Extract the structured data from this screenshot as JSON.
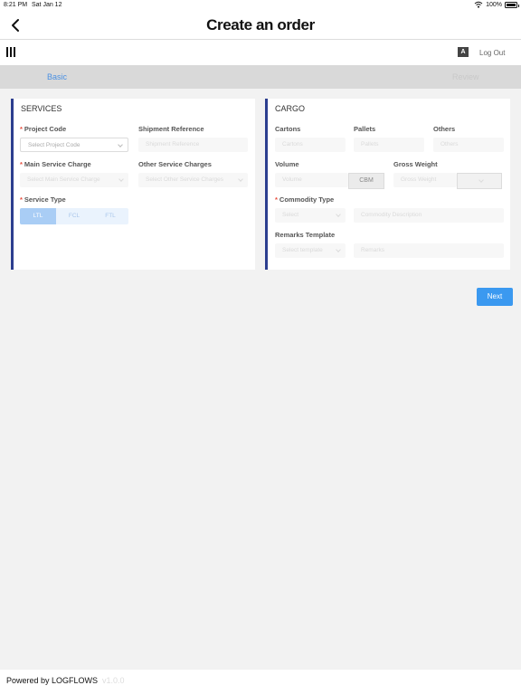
{
  "status_bar": {
    "time": "8:21 PM",
    "date": "Sat Jan 12",
    "battery": "100%",
    "battery_level": 1.0
  },
  "header": {
    "title": "Create an order"
  },
  "toolbar": {
    "logout_label": "Log Out",
    "lang_icon_glyph": "A"
  },
  "tabs": [
    {
      "label": "Basic"
    },
    {
      "label": "Review"
    }
  ],
  "services": {
    "title": "SERVICES",
    "project_code": {
      "label": "Project Code",
      "placeholder": "Select Project Code"
    },
    "shipment_reference": {
      "label": "Shipment Reference",
      "placeholder": "Shipment Reference"
    },
    "main_service_charge": {
      "label": "Main Service Charge",
      "placeholder": "Select Main Service Charge"
    },
    "other_service_charges": {
      "label": "Other Service Charges",
      "placeholder": "Select Other Service Charges"
    },
    "service_type": {
      "label": "Service Type",
      "options": [
        "LTL",
        "FCL",
        "FTL"
      ],
      "selected": "LTL"
    }
  },
  "cargo": {
    "title": "CARGO",
    "cartons": {
      "label": "Cartons",
      "placeholder": "Cartons"
    },
    "pallets": {
      "label": "Pallets",
      "placeholder": "Pallets"
    },
    "others": {
      "label": "Others",
      "placeholder": "Others"
    },
    "volume": {
      "label": "Volume",
      "placeholder": "Volume",
      "unit": "CBM"
    },
    "gross_weight": {
      "label": "Gross Weight",
      "placeholder": "Gross Weight"
    },
    "commodity_type": {
      "label": "Commodity Type",
      "select_placeholder": "Select",
      "description_placeholder": "Commodity Description"
    },
    "remarks_template": {
      "label": "Remarks Template",
      "select_placeholder": "Select template",
      "remarks_placeholder": "Remarks"
    }
  },
  "actions": {
    "next_label": "Next"
  },
  "footer": {
    "powered_by": "Powered by LOGFLOWS",
    "version": "v1.0.0"
  },
  "colors": {
    "accent": "#3b99f0",
    "card_border": "#2c3e8f",
    "required": "#e74c3c",
    "tab_bar": "#d9d9d9"
  }
}
